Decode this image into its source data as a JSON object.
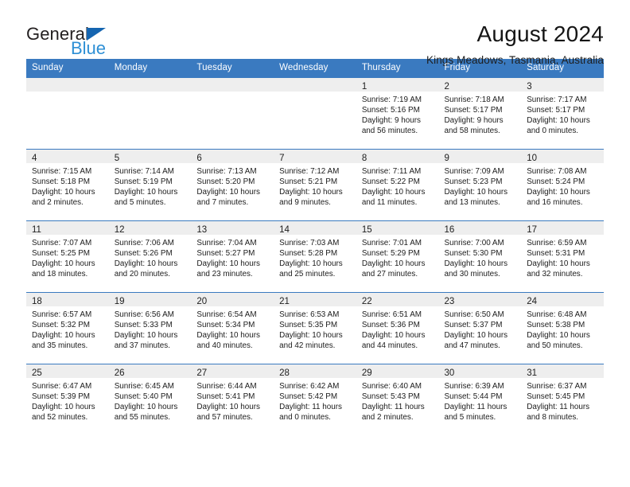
{
  "brand": {
    "name_top": "General",
    "name_bottom": "Blue",
    "accent_color": "#1565b0",
    "blue_text_color": "#2d8fd5"
  },
  "header": {
    "title": "August 2024",
    "subtitle": "Kings Meadows, Tasmania, Australia"
  },
  "theme": {
    "header_row_bg": "#3a7ac0",
    "header_row_text": "#ffffff",
    "daynum_band_bg": "#eeeeee",
    "cell_border": "#3a7ac0"
  },
  "weekdays": [
    "Sunday",
    "Monday",
    "Tuesday",
    "Wednesday",
    "Thursday",
    "Friday",
    "Saturday"
  ],
  "labels": {
    "sunrise_prefix": "Sunrise:",
    "sunset_prefix": "Sunset:",
    "daylight_prefix": "Daylight:"
  },
  "weeks": [
    [
      {
        "day": "",
        "line1": "",
        "line2": "",
        "line3": "",
        "line4": ""
      },
      {
        "day": "",
        "line1": "",
        "line2": "",
        "line3": "",
        "line4": ""
      },
      {
        "day": "",
        "line1": "",
        "line2": "",
        "line3": "",
        "line4": ""
      },
      {
        "day": "",
        "line1": "",
        "line2": "",
        "line3": "",
        "line4": ""
      },
      {
        "day": "1",
        "line1": "Sunrise: 7:19 AM",
        "line2": "Sunset: 5:16 PM",
        "line3": "Daylight: 9 hours",
        "line4": "and 56 minutes."
      },
      {
        "day": "2",
        "line1": "Sunrise: 7:18 AM",
        "line2": "Sunset: 5:17 PM",
        "line3": "Daylight: 9 hours",
        "line4": "and 58 minutes."
      },
      {
        "day": "3",
        "line1": "Sunrise: 7:17 AM",
        "line2": "Sunset: 5:17 PM",
        "line3": "Daylight: 10 hours",
        "line4": "and 0 minutes."
      }
    ],
    [
      {
        "day": "4",
        "line1": "Sunrise: 7:15 AM",
        "line2": "Sunset: 5:18 PM",
        "line3": "Daylight: 10 hours",
        "line4": "and 2 minutes."
      },
      {
        "day": "5",
        "line1": "Sunrise: 7:14 AM",
        "line2": "Sunset: 5:19 PM",
        "line3": "Daylight: 10 hours",
        "line4": "and 5 minutes."
      },
      {
        "day": "6",
        "line1": "Sunrise: 7:13 AM",
        "line2": "Sunset: 5:20 PM",
        "line3": "Daylight: 10 hours",
        "line4": "and 7 minutes."
      },
      {
        "day": "7",
        "line1": "Sunrise: 7:12 AM",
        "line2": "Sunset: 5:21 PM",
        "line3": "Daylight: 10 hours",
        "line4": "and 9 minutes."
      },
      {
        "day": "8",
        "line1": "Sunrise: 7:11 AM",
        "line2": "Sunset: 5:22 PM",
        "line3": "Daylight: 10 hours",
        "line4": "and 11 minutes."
      },
      {
        "day": "9",
        "line1": "Sunrise: 7:09 AM",
        "line2": "Sunset: 5:23 PM",
        "line3": "Daylight: 10 hours",
        "line4": "and 13 minutes."
      },
      {
        "day": "10",
        "line1": "Sunrise: 7:08 AM",
        "line2": "Sunset: 5:24 PM",
        "line3": "Daylight: 10 hours",
        "line4": "and 16 minutes."
      }
    ],
    [
      {
        "day": "11",
        "line1": "Sunrise: 7:07 AM",
        "line2": "Sunset: 5:25 PM",
        "line3": "Daylight: 10 hours",
        "line4": "and 18 minutes."
      },
      {
        "day": "12",
        "line1": "Sunrise: 7:06 AM",
        "line2": "Sunset: 5:26 PM",
        "line3": "Daylight: 10 hours",
        "line4": "and 20 minutes."
      },
      {
        "day": "13",
        "line1": "Sunrise: 7:04 AM",
        "line2": "Sunset: 5:27 PM",
        "line3": "Daylight: 10 hours",
        "line4": "and 23 minutes."
      },
      {
        "day": "14",
        "line1": "Sunrise: 7:03 AM",
        "line2": "Sunset: 5:28 PM",
        "line3": "Daylight: 10 hours",
        "line4": "and 25 minutes."
      },
      {
        "day": "15",
        "line1": "Sunrise: 7:01 AM",
        "line2": "Sunset: 5:29 PM",
        "line3": "Daylight: 10 hours",
        "line4": "and 27 minutes."
      },
      {
        "day": "16",
        "line1": "Sunrise: 7:00 AM",
        "line2": "Sunset: 5:30 PM",
        "line3": "Daylight: 10 hours",
        "line4": "and 30 minutes."
      },
      {
        "day": "17",
        "line1": "Sunrise: 6:59 AM",
        "line2": "Sunset: 5:31 PM",
        "line3": "Daylight: 10 hours",
        "line4": "and 32 minutes."
      }
    ],
    [
      {
        "day": "18",
        "line1": "Sunrise: 6:57 AM",
        "line2": "Sunset: 5:32 PM",
        "line3": "Daylight: 10 hours",
        "line4": "and 35 minutes."
      },
      {
        "day": "19",
        "line1": "Sunrise: 6:56 AM",
        "line2": "Sunset: 5:33 PM",
        "line3": "Daylight: 10 hours",
        "line4": "and 37 minutes."
      },
      {
        "day": "20",
        "line1": "Sunrise: 6:54 AM",
        "line2": "Sunset: 5:34 PM",
        "line3": "Daylight: 10 hours",
        "line4": "and 40 minutes."
      },
      {
        "day": "21",
        "line1": "Sunrise: 6:53 AM",
        "line2": "Sunset: 5:35 PM",
        "line3": "Daylight: 10 hours",
        "line4": "and 42 minutes."
      },
      {
        "day": "22",
        "line1": "Sunrise: 6:51 AM",
        "line2": "Sunset: 5:36 PM",
        "line3": "Daylight: 10 hours",
        "line4": "and 44 minutes."
      },
      {
        "day": "23",
        "line1": "Sunrise: 6:50 AM",
        "line2": "Sunset: 5:37 PM",
        "line3": "Daylight: 10 hours",
        "line4": "and 47 minutes."
      },
      {
        "day": "24",
        "line1": "Sunrise: 6:48 AM",
        "line2": "Sunset: 5:38 PM",
        "line3": "Daylight: 10 hours",
        "line4": "and 50 minutes."
      }
    ],
    [
      {
        "day": "25",
        "line1": "Sunrise: 6:47 AM",
        "line2": "Sunset: 5:39 PM",
        "line3": "Daylight: 10 hours",
        "line4": "and 52 minutes."
      },
      {
        "day": "26",
        "line1": "Sunrise: 6:45 AM",
        "line2": "Sunset: 5:40 PM",
        "line3": "Daylight: 10 hours",
        "line4": "and 55 minutes."
      },
      {
        "day": "27",
        "line1": "Sunrise: 6:44 AM",
        "line2": "Sunset: 5:41 PM",
        "line3": "Daylight: 10 hours",
        "line4": "and 57 minutes."
      },
      {
        "day": "28",
        "line1": "Sunrise: 6:42 AM",
        "line2": "Sunset: 5:42 PM",
        "line3": "Daylight: 11 hours",
        "line4": "and 0 minutes."
      },
      {
        "day": "29",
        "line1": "Sunrise: 6:40 AM",
        "line2": "Sunset: 5:43 PM",
        "line3": "Daylight: 11 hours",
        "line4": "and 2 minutes."
      },
      {
        "day": "30",
        "line1": "Sunrise: 6:39 AM",
        "line2": "Sunset: 5:44 PM",
        "line3": "Daylight: 11 hours",
        "line4": "and 5 minutes."
      },
      {
        "day": "31",
        "line1": "Sunrise: 6:37 AM",
        "line2": "Sunset: 5:45 PM",
        "line3": "Daylight: 11 hours",
        "line4": "and 8 minutes."
      }
    ]
  ]
}
